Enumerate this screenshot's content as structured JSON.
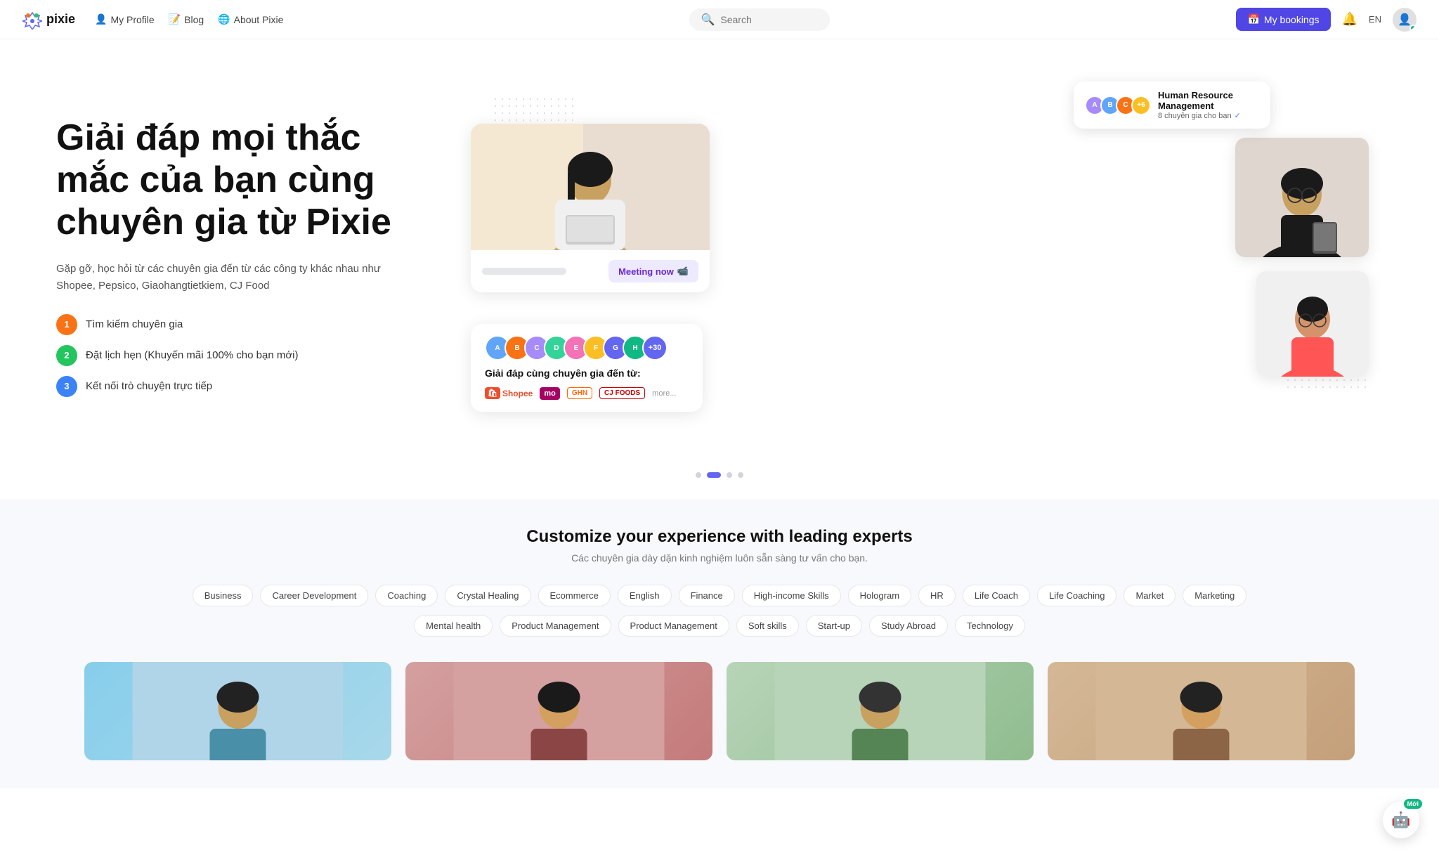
{
  "brand": {
    "logo_text": "pixie",
    "logo_icon": "✦"
  },
  "navbar": {
    "my_profile": "My Profile",
    "blog": "Blog",
    "about_pixie": "About Pixie",
    "search_placeholder": "Search",
    "my_bookings": "My bookings",
    "language": "EN"
  },
  "hero": {
    "title": "Giải đáp mọi thắc mắc của bạn cùng chuyên gia từ Pixie",
    "subtitle": "Gặp gỡ, học hỏi từ các chuyên gia đến từ các công ty khác nhau như Shopee, Pepsico, Giaohangtietkiem, CJ Food",
    "steps": [
      {
        "num": "1",
        "color": "orange",
        "text": "Tìm kiếm chuyên gia"
      },
      {
        "num": "2",
        "color": "green",
        "text": "Đặt lịch hẹn (Khuyến mãi 100% cho bạn mới)"
      },
      {
        "num": "3",
        "color": "blue",
        "text": "Kết nối trò chuyện trực tiếp"
      }
    ]
  },
  "card_hr": {
    "title": "Human Resource Management",
    "subtitle": "8 chuyên gia cho bạn",
    "count": "+6"
  },
  "card_meeting": {
    "button": "Meeting now",
    "icon": "📹"
  },
  "card_companies": {
    "text": "Giải đáp cùng chuyên gia đến từ:",
    "count": "+30",
    "logos": [
      "Shopee",
      "momo",
      "GHN",
      "CJ FOODS"
    ],
    "more": "more..."
  },
  "dots": [
    {
      "active": false
    },
    {
      "active": true
    },
    {
      "active": false
    },
    {
      "active": false
    }
  ],
  "categories": {
    "title": "Customize your experience with leading experts",
    "subtitle": "Các chuyên gia dày dặn kinh nghiệm luôn sẵn sàng tư vấn cho bạn.",
    "tags_row1": [
      "Business",
      "Career Development",
      "Coaching",
      "Crystal Healing",
      "Ecommerce",
      "English",
      "Finance",
      "High-income Skills",
      "Hologram",
      "HR",
      "Life Coach",
      "Life Coaching",
      "Market",
      "Marketing"
    ],
    "tags_row2": [
      "Mental health",
      "Product Management",
      "Product Management",
      "Soft skills",
      "Start-up",
      "Study Abroad",
      "Technology"
    ]
  },
  "chat_badge": "Mới"
}
